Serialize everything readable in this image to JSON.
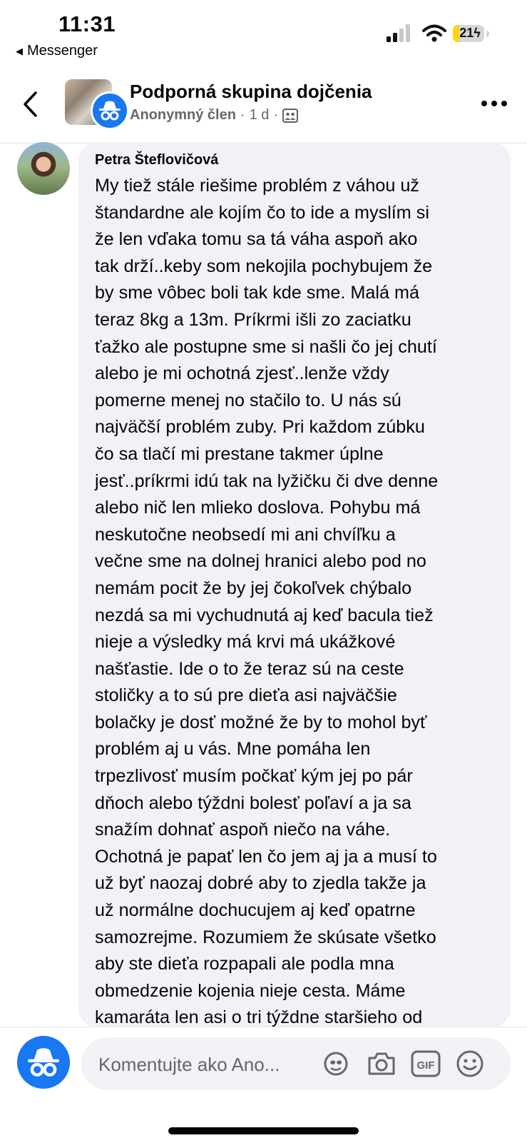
{
  "status_bar": {
    "time": "11:31",
    "back_app": "Messenger",
    "battery_level": "21",
    "battery_charging": true,
    "icons": [
      "signal-icon",
      "wifi-icon",
      "battery-icon"
    ]
  },
  "header": {
    "group_name": "Podporná skupina dojčenia",
    "author": "Anonymný člen",
    "separator": "·",
    "age": "1 d",
    "icons": [
      "back-icon",
      "anonymous-icon",
      "group-audience-icon",
      "more-icon"
    ]
  },
  "comment": {
    "author": "Petra Šteflovičová",
    "lines": [
      "My tiež stále riešime problém z váhou už",
      "štandardne ale kojím čo to ide a myslím si",
      "že len vďaka tomu sa tá váha aspoň ako",
      "tak drží..keby som nekojila pochybujem že",
      "by sme vôbec boli tak kde sme. Malá má",
      "teraz 8kg a 13m. Príkrmi išli zo zaciatku",
      "ťažko ale postupne sme si našli čo jej chutí",
      "alebo je mi ochotná zjesť..lenže vždy",
      "pomerne menej no stačilo to. U nás sú",
      "najväčší problém zuby. Pri každom zúbku",
      "čo sa tlačí mi prestane takmer úplne",
      "jesť..príkrmi idú tak na lyžičku či dve denne",
      "alebo nič len mlieko doslova. Pohybu má",
      "neskutočne neobsedí mi ani chvíľku a",
      "večne sme na dolnej hranici alebo pod no",
      "nemám pocit že by jej čokoľvek chýbalo",
      "nezdá sa mi vychudnutá aj keď bacula tiež",
      "nieje a výsledky má krvi má ukážkové",
      "našťastie. Ide o to že teraz sú na ceste",
      "stoličky a to sú pre dieťa asi najväčšie",
      "bolačky je dosť možné že by to mohol byť",
      "problém aj u vás. Mne pomáha len",
      "trpezlivosť musím počkať kým jej po pár",
      "dňoch alebo týždni bolesť poľaví a ja sa",
      "snažím dohnať aspoň niečo na váhe.",
      "Ochotná je papať len čo jem aj ja a musí to",
      "už byť naozaj dobré aby to zjedla takže ja",
      "už normálne dochucujem aj keď opatrne",
      "samozrejme. Rozumiem že skúsate všetko",
      "aby ste dieťa rozpapali ale podla mna",
      "obmedzenie kojenia nieje cesta. Máme",
      "kamaráta len asi o tri týždne staršieho od"
    ]
  },
  "composer": {
    "placeholder": "Komentujte ako Ano...",
    "tools": [
      "avatar-sticker-icon",
      "camera-icon",
      "gif-icon",
      "emoji-icon"
    ],
    "gif_label": "GIF"
  },
  "colors": {
    "accent": "#1877f2",
    "bubble": "#f0f2f5",
    "secondary_text": "#65676b",
    "battery": "#ffd60a"
  }
}
